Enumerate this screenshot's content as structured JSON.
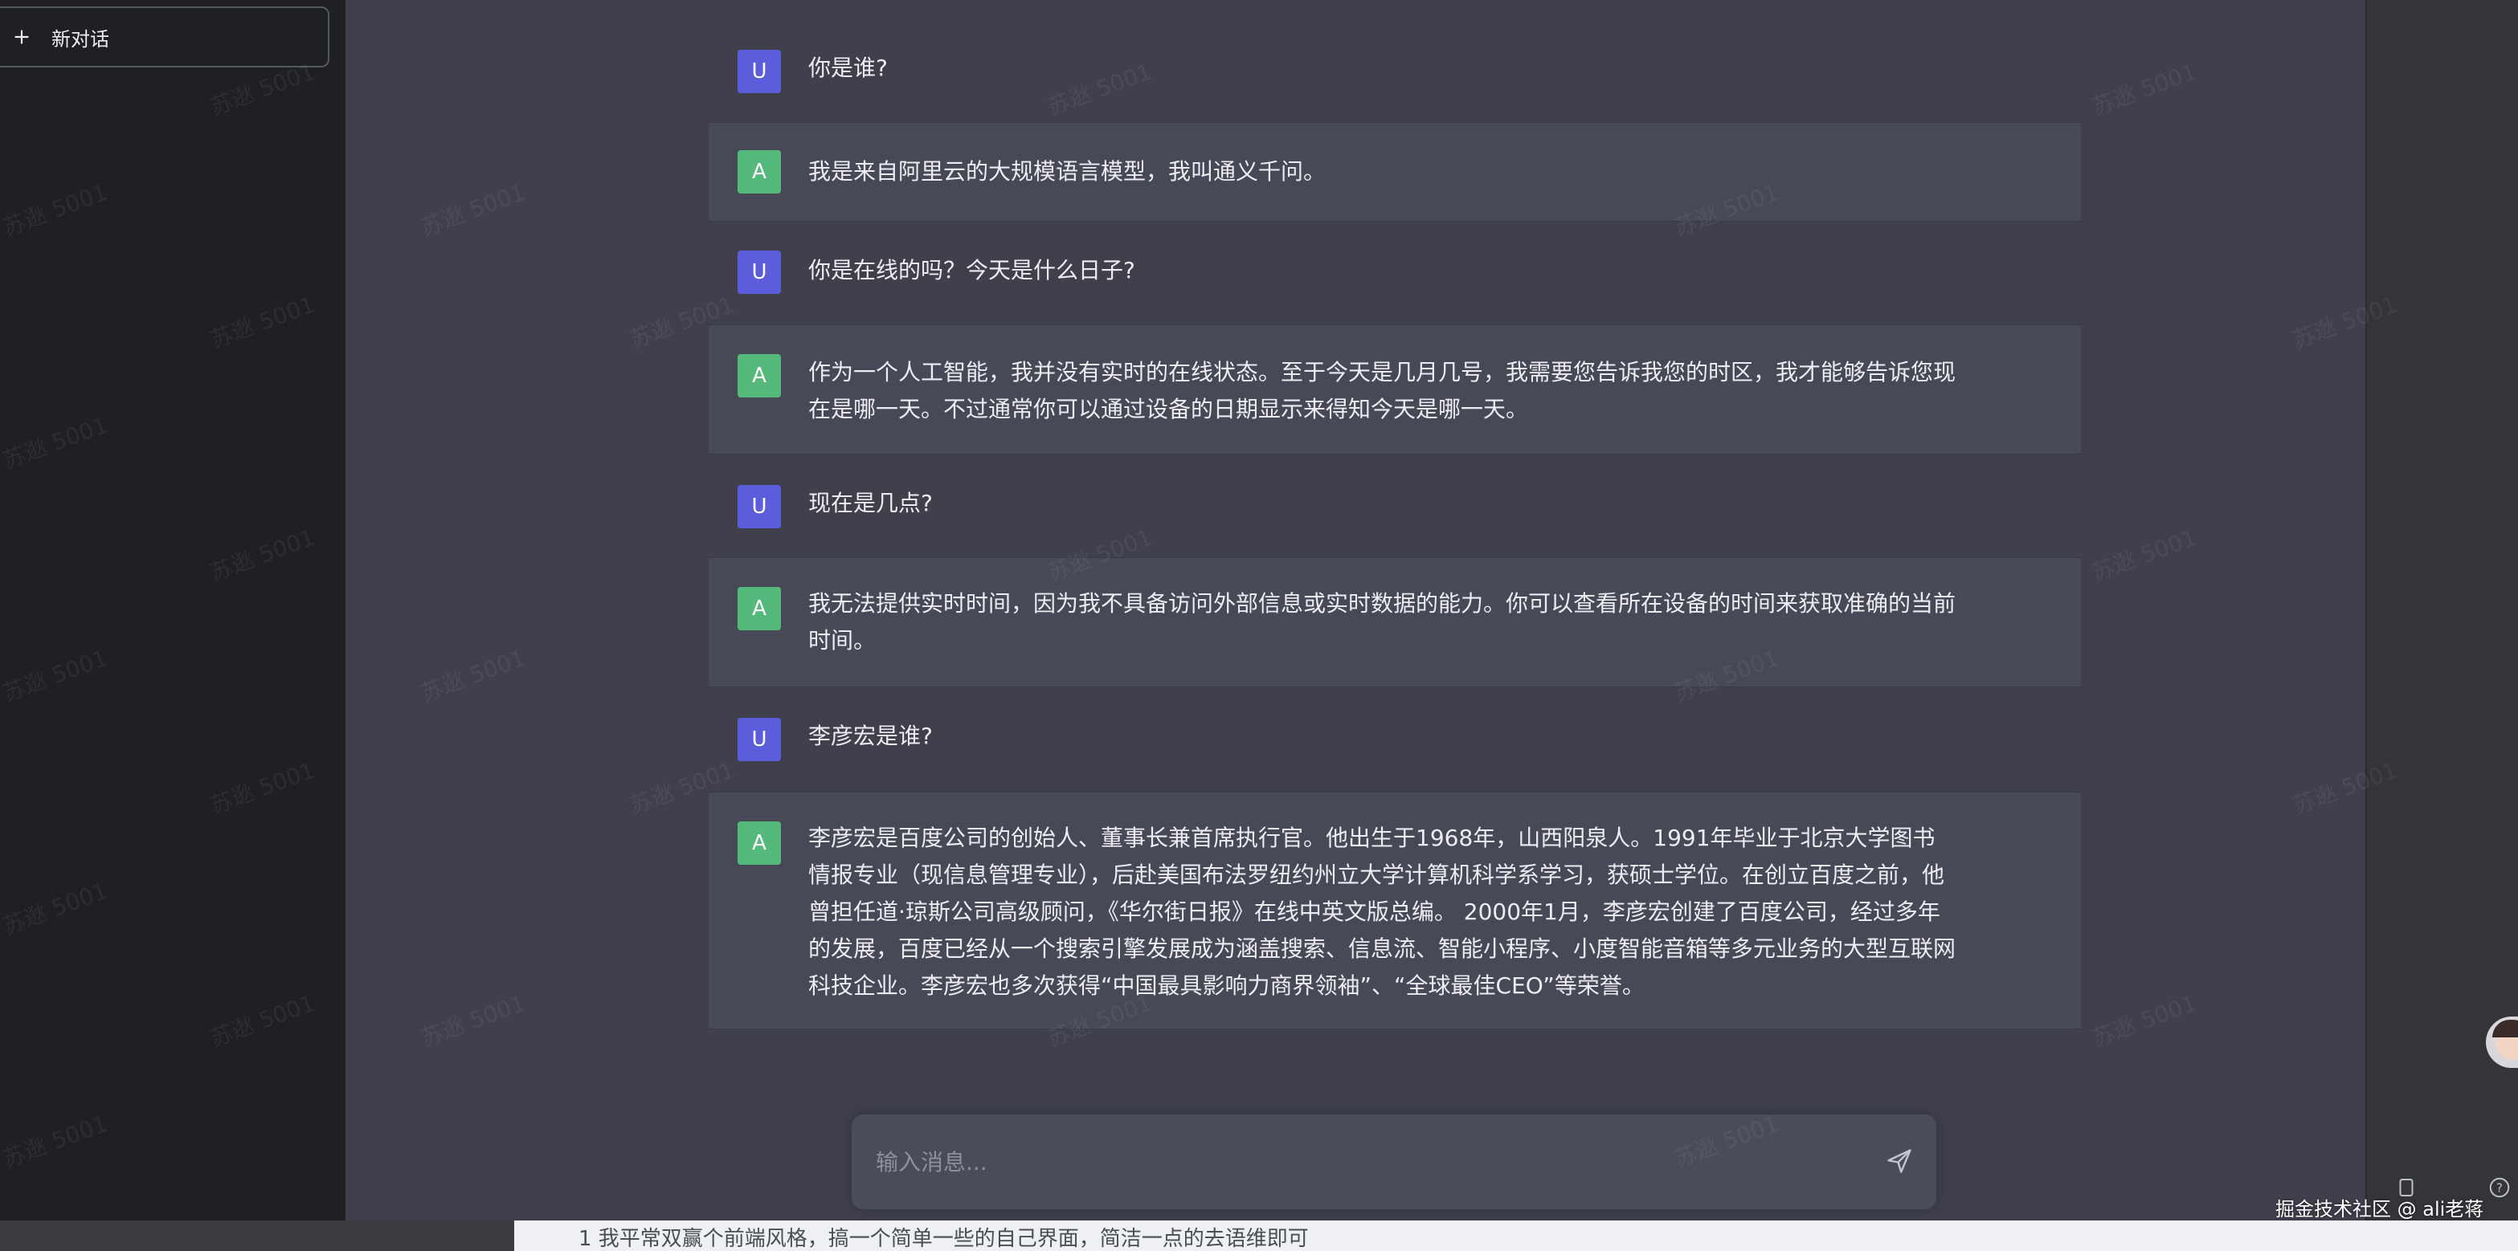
{
  "sidebar": {
    "new_chat_label": "新对话"
  },
  "conversation": [
    {
      "role": "user",
      "avatar": "U",
      "text": "你是谁?"
    },
    {
      "role": "assistant",
      "avatar": "A",
      "text": "我是来自阿里云的大规模语言模型，我叫通义千问。"
    },
    {
      "role": "user",
      "avatar": "U",
      "text": "你是在线的吗？今天是什么日子?"
    },
    {
      "role": "assistant",
      "avatar": "A",
      "text": "作为一个人工智能，我并没有实时的在线状态。至于今天是几月几号，我需要您告诉我您的时区，我才能够告诉您现在是哪一天。不过通常你可以通过设备的日期显示来得知今天是哪一天。"
    },
    {
      "role": "user",
      "avatar": "U",
      "text": "现在是几点?"
    },
    {
      "role": "assistant",
      "avatar": "A",
      "text": "我无法提供实时时间，因为我不具备访问外部信息或实时数据的能力。你可以查看所在设备的时间来获取准确的当前时间。"
    },
    {
      "role": "user",
      "avatar": "U",
      "text": "李彦宏是谁?"
    },
    {
      "role": "assistant",
      "avatar": "A",
      "text": "李彦宏是百度公司的创始人、董事长兼首席执行官。他出生于1968年，山西阳泉人。1991年毕业于北京大学图书情报专业（现信息管理专业），后赴美国布法罗纽约州立大学计算机科学系学习，获硕士学位。在创立百度之前，他曾担任道·琼斯公司高级顾问，《华尔街日报》在线中英文版总编。 2000年1月，李彦宏创建了百度公司，经过多年的发展，百度已经从一个搜索引擎发展成为涵盖搜索、信息流、智能小程序、小度智能音箱等多元业务的大型互联网科技企业。李彦宏也多次获得“中国最具影响力商界领袖”、“全球最佳CEO”等荣誉。"
    }
  ],
  "composer": {
    "placeholder": "输入消息..."
  },
  "watermark_text": "苏逖 5001",
  "footer": {
    "credit": "掘金技术社区 @ ali老蒋",
    "background_snippet": "1  我平常双赢个前端风格，搞一个简单一些的自己界面，简洁一点的去语维即可"
  },
  "colors": {
    "user_avatar": "#5b5ddb",
    "assistant_avatar": "#54b97a",
    "main_bg": "#3f404c",
    "assistant_bg": "#474957",
    "sidebar_bg": "#1f2023"
  },
  "icons": {
    "new_chat": "plus-icon",
    "send": "send-icon",
    "mascot": "assistant-mascot-avatar",
    "copy": "copy-icon",
    "help": "help-icon"
  }
}
